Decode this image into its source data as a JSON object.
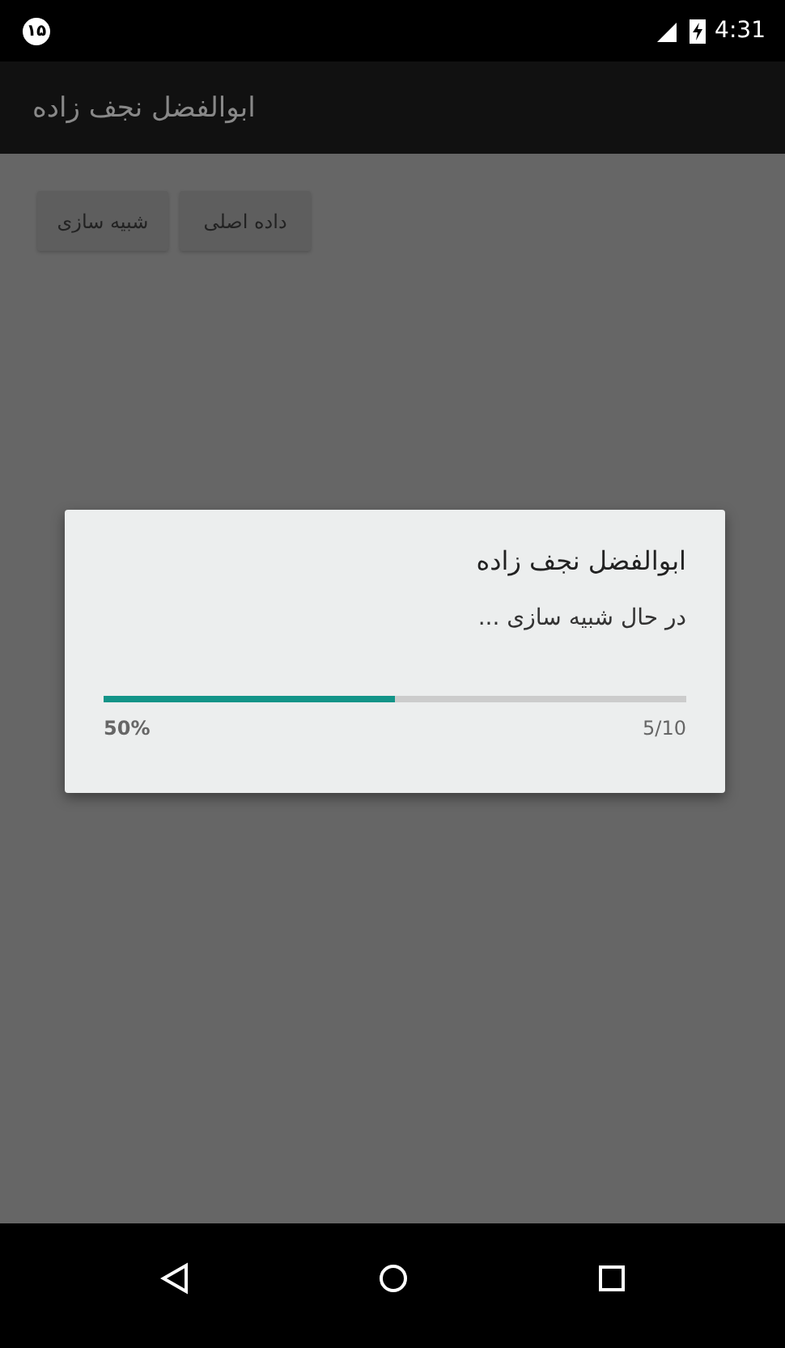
{
  "status_bar": {
    "notification": "۱۵",
    "time": "4:31"
  },
  "app_bar": {
    "title": "ابوالفضل نجف زاده"
  },
  "buttons": [
    {
      "label": "داده اصلی"
    },
    {
      "label": "شبیه سازی"
    }
  ],
  "dialog": {
    "title": "ابوالفضل نجف زاده",
    "message": "در حال شبیه سازی ...",
    "progress": {
      "level": 0.5,
      "percent": "50%",
      "count": "5/10"
    }
  }
}
